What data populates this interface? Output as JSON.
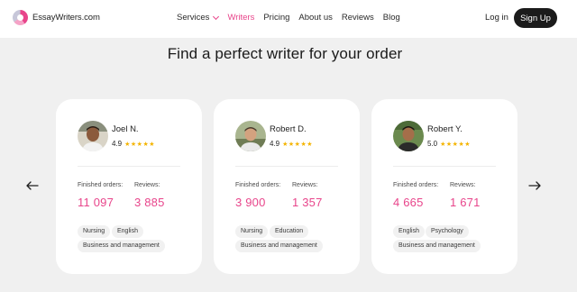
{
  "header": {
    "logo_text": "EssayWriters.com",
    "nav": [
      {
        "label": "Services"
      },
      {
        "label": "Writers"
      },
      {
        "label": "Pricing"
      },
      {
        "label": "About us"
      },
      {
        "label": "Reviews"
      },
      {
        "label": "Blog"
      }
    ],
    "active_nav": "Writers",
    "login_label": "Log in",
    "signup_label": "Sign Up"
  },
  "section": {
    "title": "Find a perfect writer for your order"
  },
  "colors": {
    "accent": "#e8458b",
    "star": "#f4b400",
    "dark_button": "#1b1b1b"
  },
  "carousel": {
    "prev_icon": "arrow-left-icon",
    "next_icon": "arrow-right-icon"
  },
  "writers": [
    {
      "name": "Joel N.",
      "rating": "4.9",
      "stars": "★★★★★",
      "finished_label": "Finished orders:",
      "finished": "11 097",
      "reviews_label": "Reviews:",
      "reviews": "3 885",
      "tags": [
        "Nursing",
        "English",
        "Business and management"
      ]
    },
    {
      "name": "Robert D.",
      "rating": "4.9",
      "stars": "★★★★★",
      "finished_label": "Finished orders:",
      "finished": "3 900",
      "reviews_label": "Reviews:",
      "reviews": "1 357",
      "tags": [
        "Nursing",
        "Education",
        "Business and management"
      ]
    },
    {
      "name": "Robert Y.",
      "rating": "5.0",
      "stars": "★★★★★",
      "finished_label": "Finished orders:",
      "finished": "4 665",
      "reviews_label": "Reviews:",
      "reviews": "1 671",
      "tags": [
        "English",
        "Psychology",
        "Business and management"
      ]
    }
  ]
}
